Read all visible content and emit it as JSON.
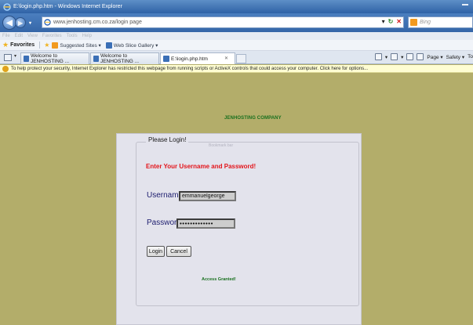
{
  "window": {
    "title": "E:\\login.php.htm - Windows Internet Explorer"
  },
  "address_bar": {
    "url": "www.jenhosting.cm.co.za/login page"
  },
  "search": {
    "placeholder": "Bing"
  },
  "menu": {
    "items": [
      "File",
      "Edit",
      "View",
      "Favorites",
      "Tools",
      "Help"
    ]
  },
  "favorites_bar": {
    "label": "Favorites",
    "links": [
      "Suggested Sites ▾",
      "Web Slice Gallery ▾"
    ]
  },
  "tabs": [
    {
      "label": "Welcome to JENHOSTING ..."
    },
    {
      "label": "Welcome to JENHOSTING ..."
    },
    {
      "label": "E:\\login.php.htm"
    }
  ],
  "command_bar": {
    "items": [
      "Page ▾",
      "Safety ▾",
      "To"
    ]
  },
  "info_bar": {
    "text": "To help protect your security, Internet Explorer has restricted this webpage from running scripts or ActiveX controls that could access your computer. Click here for options..."
  },
  "page": {
    "company": "JENHOSTING COMPANY",
    "ghost_text": "Bookmark bar",
    "legend": "Please Login!",
    "instruction": "Enter Your Username and Password!",
    "username_label": "Username:",
    "username_value": "emmanuelgeorge",
    "password_label": "Password:",
    "password_value": "•••••••••••••",
    "login_button": "Login",
    "cancel_button": "Cancel",
    "status": "Access Granted!"
  },
  "colors": {
    "page_background": "#b3ad6a",
    "panel_background": "#e3e3ec",
    "instruction_color": "#e3151b",
    "status_color": "#18701e"
  }
}
